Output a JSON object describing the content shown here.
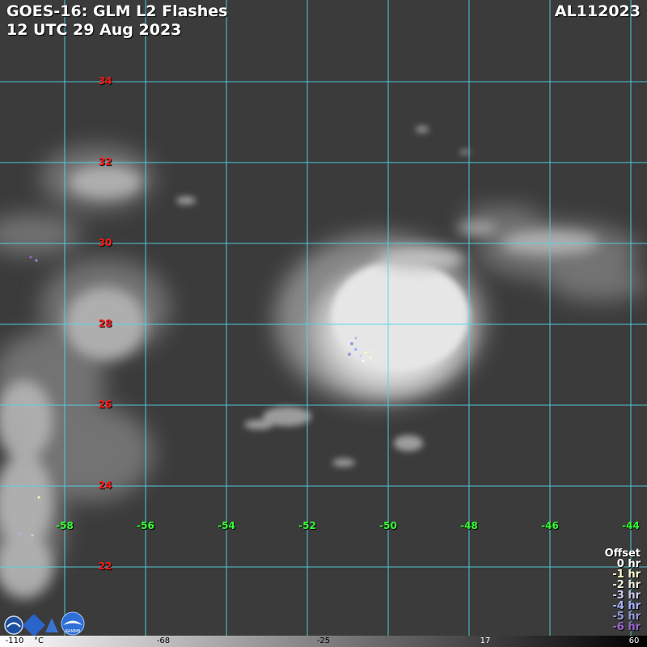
{
  "header": {
    "product": "GOES-16: GLM L2 Flashes",
    "datetime": "12 UTC 29 Aug 2023",
    "storm_id": "AL112023"
  },
  "grid": {
    "latitudes": [
      "34",
      "32",
      "30",
      "28",
      "26",
      "24",
      "22"
    ],
    "longitudes": [
      "-58",
      "-56",
      "-54",
      "-52",
      "-50",
      "-48",
      "-46",
      "-44"
    ]
  },
  "offset_legend": {
    "title": "Offset",
    "items": [
      {
        "label": "0 hr",
        "color": "#ffffff"
      },
      {
        "label": "-1 hr",
        "color": "#ffffcc"
      },
      {
        "label": "-2 hr",
        "color": "#eeeedd"
      },
      {
        "label": "-3 hr",
        "color": "#ccccee"
      },
      {
        "label": "-4 hr",
        "color": "#aab4ff"
      },
      {
        "label": "-5 hr",
        "color": "#9999dd"
      },
      {
        "label": "-6 hr",
        "color": "#9966cc"
      }
    ]
  },
  "colorbar": {
    "labels": [
      "-110",
      "°C",
      "-68",
      "-25",
      "17",
      "60"
    ]
  },
  "colors": {
    "grid_line": "#4fd8e6",
    "lat_label": "#ff1a1a",
    "lon_label": "#33ff33"
  }
}
